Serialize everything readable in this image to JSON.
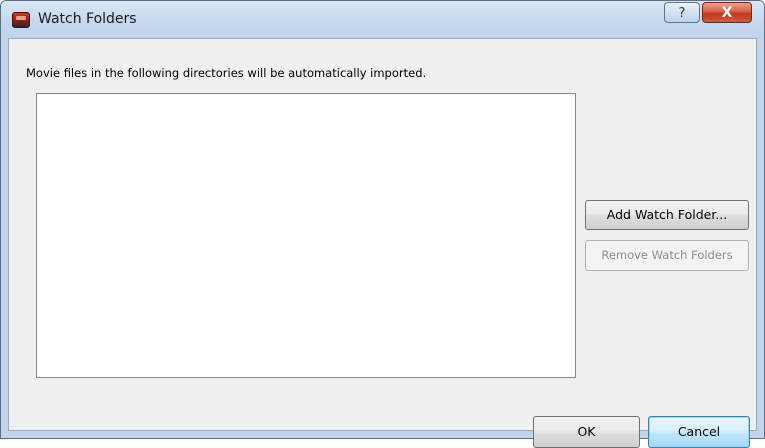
{
  "window": {
    "title": "Watch Folders",
    "help_label": "?",
    "close_label": "X"
  },
  "main": {
    "description": "Movie files in the following directories will be automatically imported.",
    "folders": []
  },
  "buttons": {
    "add_label": "Add Watch Folder...",
    "remove_label": "Remove Watch Folders",
    "ok_label": "OK",
    "cancel_label": "Cancel"
  },
  "colors": {
    "title_bar": "#c8d9ee",
    "client_background": "#f0f0f0",
    "close_button": "#c0391f",
    "focused_button": "#bee6fd"
  },
  "icons": {
    "app": "film-app-icon",
    "help": "help-icon",
    "close": "close-icon"
  }
}
